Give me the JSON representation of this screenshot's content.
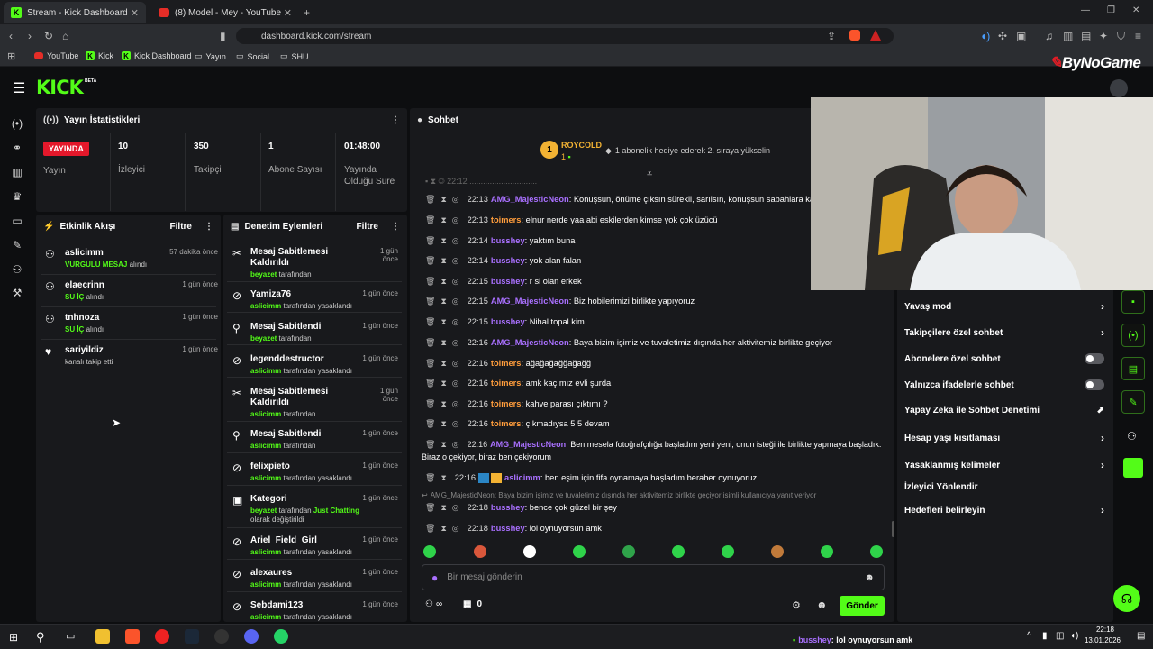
{
  "browser": {
    "tabs": [
      {
        "title": "Stream - Kick Dashboard"
      },
      {
        "title": "(8) Model - Mey - YouTube"
      }
    ],
    "url": "dashboard.kick.com/stream",
    "bookmarks": [
      "YouTube",
      "Kick",
      "Kick Dashboard",
      "Yayın",
      "Social",
      "SHU"
    ]
  },
  "header": {
    "logo": "KICK",
    "beta": "BETA",
    "brand_watermark": "ByNoGame"
  },
  "stats": {
    "title": "Yayın İstatistikleri",
    "live_badge": "YAYINDA",
    "live_label": "Yayın",
    "viewers": "10",
    "viewers_label": "İzleyici",
    "followers": "350",
    "followers_label": "Takipçi",
    "subs": "1",
    "subs_label": "Abone Sayısı",
    "duration": "01:48:00",
    "duration_label": "Yayında Olduğu Süre"
  },
  "activity": {
    "title": "Etkinlik Akışı",
    "filter": "Filtre",
    "items": [
      {
        "name": "aslicimm",
        "time": "57 dakika önce",
        "highlight": "VURGULU MESAJ",
        "rest": " alındı"
      },
      {
        "name": "elaecrinn",
        "time": "1 gün önce",
        "highlight": "SU İÇ",
        "rest": " alındı"
      },
      {
        "name": "tnhnoza",
        "time": "1 gün önce",
        "highlight": "SU İÇ",
        "rest": " alındı"
      },
      {
        "name": "sariyildiz",
        "time": "1 gün önce",
        "highlight": "",
        "rest": "kanalı takip etti"
      }
    ]
  },
  "moderation": {
    "title": "Denetim Eylemleri",
    "filter": "Filtre",
    "items": [
      {
        "name": "Mesaj Sabitlemesi Kaldırıldı",
        "time": "1 gün önce",
        "by": "beyazet",
        "rest": " tarafından"
      },
      {
        "name": "Yamiza76",
        "time": "1 gün önce",
        "by": "aslicimm",
        "rest": " tarafından yasaklandı"
      },
      {
        "name": "Mesaj Sabitlendi",
        "time": "1 gün önce",
        "by": "beyazet",
        "rest": " tarafından"
      },
      {
        "name": "legenddestructor",
        "time": "1 gün önce",
        "by": "aslicimm",
        "rest": " tarafından yasaklandı"
      },
      {
        "name": "Mesaj Sabitlemesi Kaldırıldı",
        "time": "1 gün önce",
        "by": "aslicimm",
        "rest": " tarafından"
      },
      {
        "name": "Mesaj Sabitlendi",
        "time": "1 gün önce",
        "by": "aslicimm",
        "rest": " tarafından"
      },
      {
        "name": "felixpieto",
        "time": "1 gün önce",
        "by": "aslicimm",
        "rest": " tarafından yasaklandı"
      },
      {
        "name": "Kategori",
        "time": "1 gün önce",
        "by": "beyazet",
        "rest": " tarafından ",
        "cat": "Just Chatting",
        "rest2": " olarak değiştirildi"
      },
      {
        "name": "Ariel_Field_Girl",
        "time": "1 gün önce",
        "by": "aslicimm",
        "rest": " tarafından yasaklandı"
      },
      {
        "name": "alexaures",
        "time": "1 gün önce",
        "by": "aslicimm",
        "rest": " tarafından yasaklandı"
      },
      {
        "name": "Sebdami123",
        "time": "1 gün önce",
        "by": "aslicimm",
        "rest": " tarafından yasaklandı"
      }
    ]
  },
  "chat": {
    "title": "Sohbet",
    "top_user": "ROYCOLD",
    "top_count": "1",
    "pinned_info": "1 abonelik hediye ederek 2. sıraya yükselin",
    "messages": [
      {
        "time": "22:13",
        "user": "AMG_MajesticNeon",
        "color": "purple",
        "text": "Konuşsun, önüme çıksın sürekli, sarılsın, konuşsun sabahlara kadar"
      },
      {
        "time": "22:13",
        "user": "toimers",
        "color": "orange",
        "text": "elnur nerde yaa abi eskilerden kimse yok çok üzücü"
      },
      {
        "time": "22:14",
        "user": "busshey",
        "color": "purple",
        "text": "yaktım buna"
      },
      {
        "time": "22:14",
        "user": "busshey",
        "color": "purple",
        "text": "yok alan falan"
      },
      {
        "time": "22:15",
        "user": "busshey",
        "color": "purple",
        "text": "r si olan erkek"
      },
      {
        "time": "22:15",
        "user": "AMG_MajesticNeon",
        "color": "purple",
        "text": "Biz hobilerimizi birlikte yapıyoruz"
      },
      {
        "time": "22:15",
        "user": "busshey",
        "color": "purple",
        "text": "Nihal topal kim"
      },
      {
        "time": "22:16",
        "user": "AMG_MajesticNeon",
        "color": "purple",
        "text": "Baya bizim işimiz ve tuvaletimiz dışında her aktivitemiz birlikte geçiyor"
      },
      {
        "time": "22:16",
        "user": "toimers",
        "color": "orange",
        "text": "ağağağağğağağğ"
      },
      {
        "time": "22:16",
        "user": "toimers",
        "color": "orange",
        "text": "amk kaçımız evli şurda"
      },
      {
        "time": "22:16",
        "user": "toimers",
        "color": "orange",
        "text": "kahve parası çıktımı ?"
      },
      {
        "time": "22:16",
        "user": "toimers",
        "color": "orange",
        "text": "çıkmadıysa 5 5 devam"
      },
      {
        "time": "22:16",
        "user": "AMG_MajesticNeon",
        "color": "purple",
        "text": "Ben mesela fotoğrafçılığa başladım yeni yeni, onun isteği ile birlikte yapmaya başladık."
      },
      {
        "time": "22:16",
        "user": "aslicimm",
        "color": "purple",
        "text": "ben eşim için fifa oynamaya başladım beraber oynuyoruz"
      },
      {
        "time": "22:18",
        "user": "busshey",
        "color": "purple",
        "text": "bence çok güzel bir şey"
      },
      {
        "time": "22:18",
        "user": "busshey",
        "color": "purple",
        "text": "lol oynuyorsun amk"
      }
    ],
    "wrap_line": "Biraz o çekiyor, biraz ben çekiyorum",
    "reply_note": "AMG_MajesticNeon: Baya bizim işimiz ve tuvaletimiz dışında her aktivitemiz birlikte geçiyor isimli kullanıcıya yanıt veriyor",
    "input_placeholder": "Bir mesaj gönderin",
    "send": "Gönder",
    "points": "0",
    "count_symbol": "∞"
  },
  "settings": {
    "items": [
      {
        "label": "Yavaş mod",
        "type": "chevron"
      },
      {
        "label": "Takipçilere özel sohbet",
        "type": "chevron"
      },
      {
        "label": "Abonelere özel sohbet",
        "type": "toggle"
      },
      {
        "label": "Yalnızca ifadelerle sohbet",
        "type": "toggle"
      },
      {
        "label": "Yapay Zeka ile Sohbet Denetimi",
        "type": "external"
      },
      {
        "label": "Hesap yaşı kısıtlaması",
        "type": "chevron"
      },
      {
        "label": "Yasaklanmış kelimeler",
        "type": "chevron"
      },
      {
        "label": "İzleyici Yönlendir",
        "type": "none"
      },
      {
        "label": "Hedefleri belirleyin",
        "type": "chevron"
      }
    ]
  },
  "taskbar": {
    "time": "22:18",
    "date": "13.01.2026",
    "overlay_user": "busshey",
    "overlay_text": ": lol oynuyorsun amk"
  },
  "colors": {
    "accent": "#53fc18",
    "purple": "#a970ff",
    "orange": "#ff9d3c"
  }
}
